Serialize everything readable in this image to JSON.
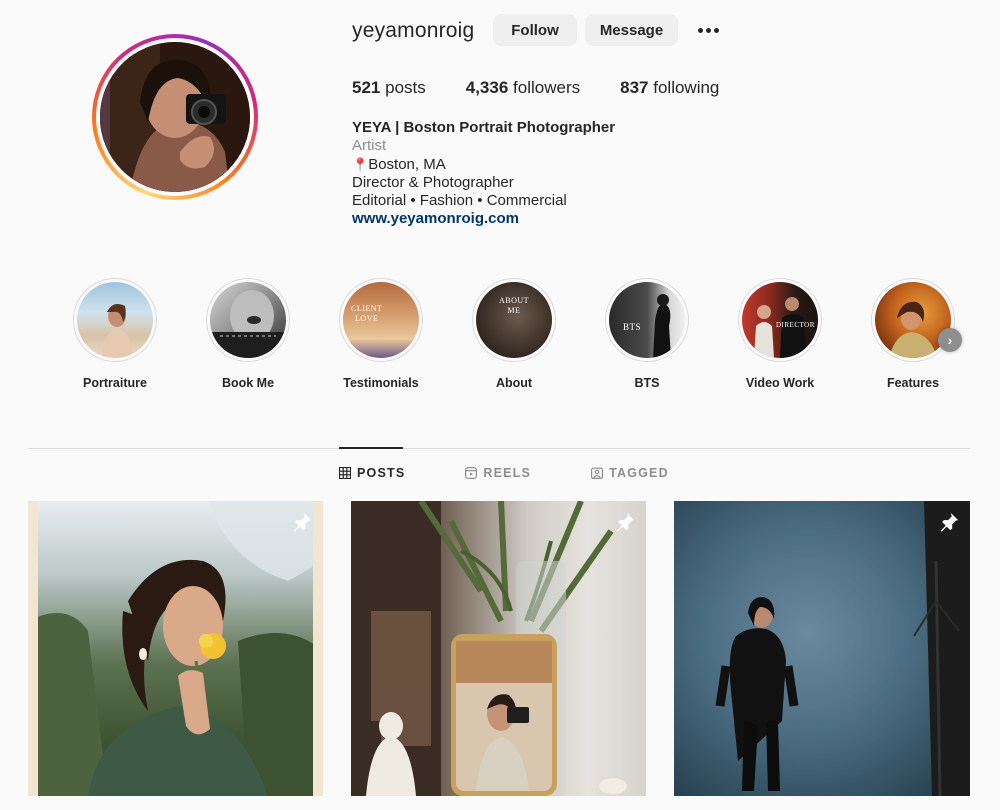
{
  "profile": {
    "username": "yeyamonroig",
    "follow_label": "Follow",
    "message_label": "Message",
    "more_icon": "more-horizontal-icon",
    "stats": {
      "posts_count": "521",
      "posts_label": "posts",
      "followers_count": "4,336",
      "followers_label": "followers",
      "following_count": "837",
      "following_label": "following"
    },
    "bio": {
      "name": "YEYA | Boston Portrait Photographer",
      "category": "Artist",
      "location_icon": "📍",
      "location": "Boston, MA",
      "line1": "Director & Photographer",
      "line2": "Editorial • Fashion • Commercial",
      "link": "www.yeyamonroig.com"
    },
    "story_ring_colors": [
      "#feda75",
      "#fa7e1e",
      "#d62976",
      "#962fbf"
    ],
    "link_color": "#00376b"
  },
  "highlights": [
    {
      "label": "Portraiture",
      "overlay": ""
    },
    {
      "label": "Book Me",
      "overlay": ""
    },
    {
      "label": "Testimonials",
      "overlay": "CLIENT\nLOVE"
    },
    {
      "label": "About",
      "overlay": "ABOUT\nME"
    },
    {
      "label": "BTS",
      "overlay": "BTS"
    },
    {
      "label": "Video Work",
      "overlay": "DIRECTOR"
    },
    {
      "label": "Features",
      "overlay": ""
    }
  ],
  "highlights_next_icon": "chevron-right-icon",
  "tabs": [
    {
      "label": "POSTS",
      "icon": "grid-icon",
      "active": true
    },
    {
      "label": "REELS",
      "icon": "reels-icon",
      "active": false
    },
    {
      "label": "TAGGED",
      "icon": "tagged-icon",
      "active": false
    }
  ],
  "posts": [
    {
      "alt": "woman holding yellow rose",
      "pinned": true
    },
    {
      "alt": "phone in vase with portrait",
      "pinned": true
    },
    {
      "alt": "woman in black on blue backdrop",
      "pinned": true
    }
  ]
}
